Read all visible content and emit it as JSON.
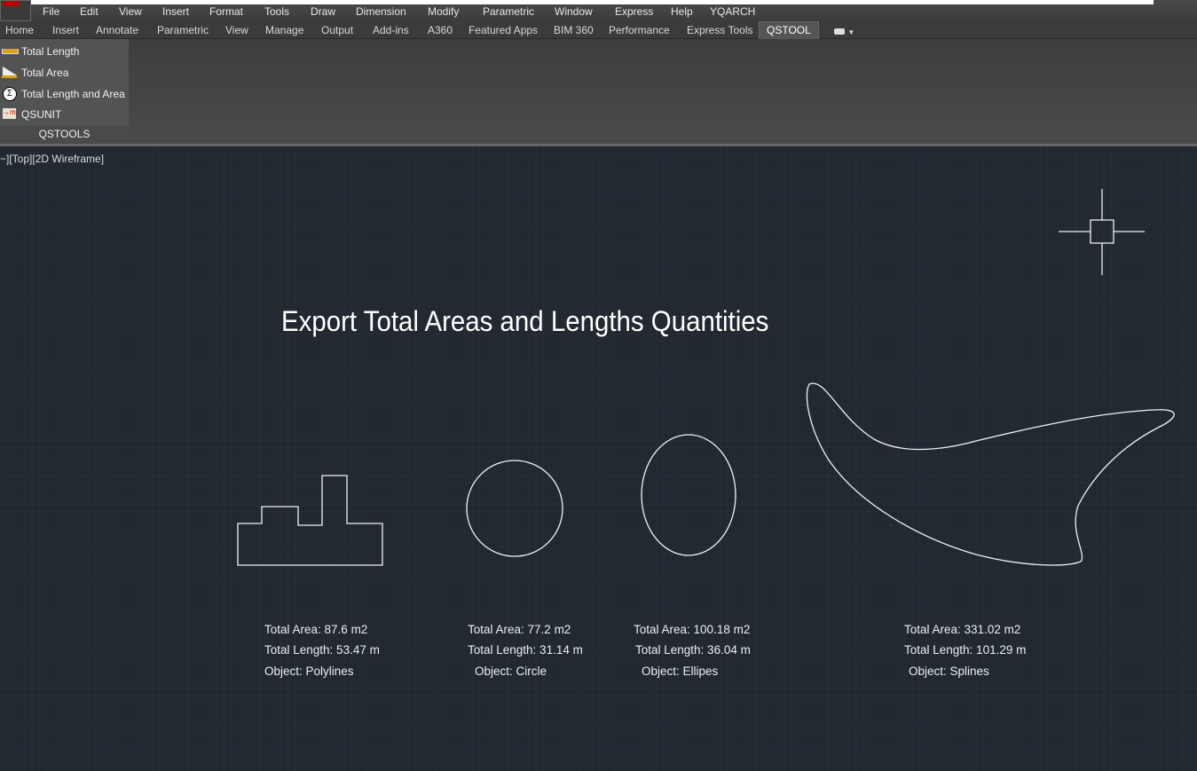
{
  "menu": [
    "File",
    "Edit",
    "View",
    "Insert",
    "Format",
    "Tools",
    "Draw",
    "Dimension",
    "Modify",
    "Parametric",
    "Window",
    "Express",
    "Help",
    "YQARCH"
  ],
  "tabs": [
    "Home",
    "Insert",
    "Annotate",
    "Parametric",
    "View",
    "Manage",
    "Output",
    "Add-ins",
    "A360",
    "Featured Apps",
    "BIM 360",
    "Performance",
    "Express Tools",
    "QSTOOL"
  ],
  "active_tab": "QSTOOL",
  "ribbon": {
    "buttons": [
      "Total Length",
      "Total Area",
      "Total Length and Area",
      "QSUNIT"
    ],
    "panel_title": "QSTOOLS"
  },
  "viewport_label": "−][Top][2D Wireframe]",
  "drawing": {
    "title": "Export Total Areas and Lengths Quantities",
    "objects": [
      {
        "area": "Total Area: 87.6 m2",
        "length": "Total Length: 53.47 m",
        "object": "Object: Polylines"
      },
      {
        "area": "Total Area: 77.2 m2",
        "length": "Total Length: 31.14 m",
        "object": "Object: Circle"
      },
      {
        "area": "Total Area: 100.18 m2",
        "length": "Total Length: 36.04 m",
        "object": "Object: Ellipes"
      },
      {
        "area": "Total Area: 331.02 m2",
        "length": "Total Length: 101.29 m",
        "object": "Object: Splines"
      }
    ]
  }
}
